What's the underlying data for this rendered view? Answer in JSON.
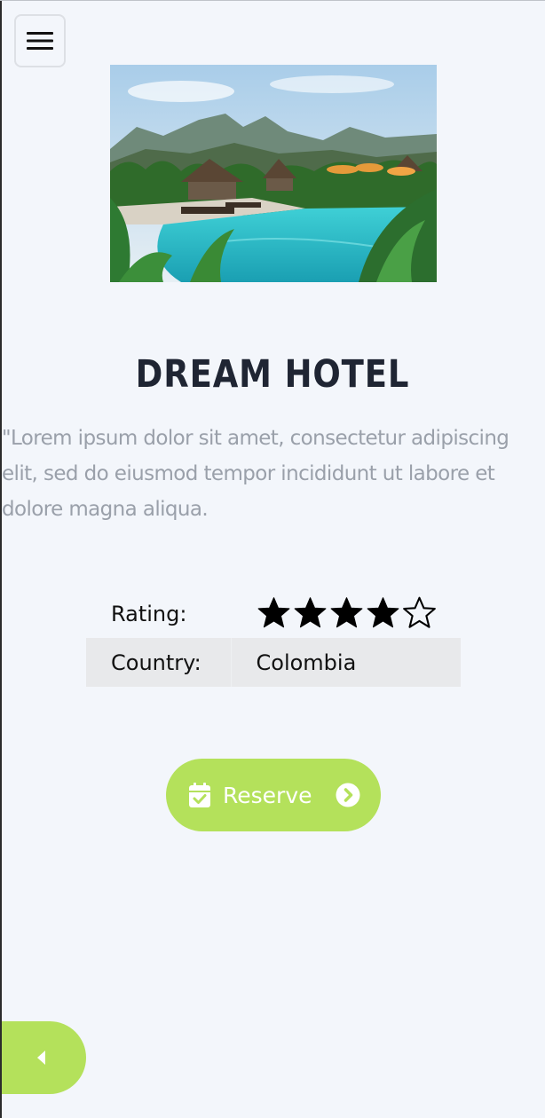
{
  "menu": {
    "icon": "hamburger-menu-icon"
  },
  "hero": {
    "image": "tropical-resort-pool-photo"
  },
  "hotel": {
    "title": "DREAM HOTEL",
    "description": "\"Lorem ipsum dolor sit amet, consectetur adipiscing elit, sed do eiusmod tempor incididunt ut labore et dolore magna aliqua."
  },
  "details": {
    "rating_label": "Rating:",
    "rating_value": 4,
    "rating_max": 5,
    "country_label": "Country:",
    "country_value": "Colombia"
  },
  "reserve": {
    "label": "Reserve",
    "icon_left": "calendar-check-icon",
    "icon_right": "chevron-circle-right-icon"
  },
  "back": {
    "icon": "caret-left-icon"
  },
  "colors": {
    "accent": "#b4e15b",
    "background": "#f3f6fb",
    "title": "#1f2533",
    "muted_text": "#9aa0aa"
  }
}
